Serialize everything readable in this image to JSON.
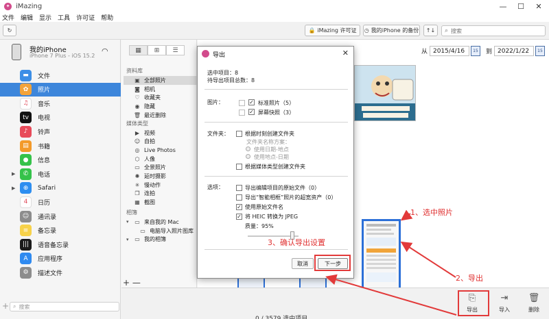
{
  "app": {
    "title": "iMazing"
  },
  "window_controls": {
    "minimize": "—",
    "maximize": "☐",
    "close": "✕"
  },
  "menu": [
    "文件",
    "编辑",
    "显示",
    "工具",
    "许可证",
    "帮助"
  ],
  "toolbar": {
    "license_label": "iMazing 许可证",
    "backup_label": "我的iPhone 的备份",
    "search_placeholder": "搜索",
    "refresh_icon": "↻",
    "sort_icon": "↑↓"
  },
  "device": {
    "name": "我的iPhone",
    "subtitle": "iPhone 7 Plus - iOS 15.2"
  },
  "sidebar": {
    "items": [
      {
        "label": "文件",
        "icon": "folder-icon",
        "color": "#3c8ee6",
        "glyph": "▬"
      },
      {
        "label": "照片",
        "icon": "photos-icon",
        "color": "#f2a33a",
        "glyph": "✿",
        "active": true
      },
      {
        "label": "音乐",
        "icon": "music-icon",
        "color": "#ffffff",
        "glyph": "♫"
      },
      {
        "label": "电视",
        "icon": "tv-icon",
        "color": "#111111",
        "glyph": "tv"
      },
      {
        "label": "铃声",
        "icon": "ringtone-icon",
        "color": "#e84b5a",
        "glyph": "♪"
      },
      {
        "label": "书籍",
        "icon": "books-icon",
        "color": "#f39a2a",
        "glyph": "▤"
      },
      {
        "label": "信息",
        "icon": "messages-icon",
        "color": "#35c24a",
        "glyph": "●"
      },
      {
        "label": "电话",
        "icon": "phone-icon",
        "color": "#35c24a",
        "glyph": "✆"
      },
      {
        "label": "Safari",
        "icon": "safari-icon",
        "color": "#2e8ef0",
        "glyph": "⊕"
      },
      {
        "label": "日历",
        "icon": "calendar-icon",
        "color": "#ffffff",
        "glyph": "4"
      },
      {
        "label": "通讯录",
        "icon": "contacts-icon",
        "color": "#8c8c8c",
        "glyph": "☺"
      },
      {
        "label": "备忘录",
        "icon": "notes-icon",
        "color": "#f7d24a",
        "glyph": "≡"
      },
      {
        "label": "语音备忘录",
        "icon": "voice-memo-icon",
        "color": "#1b1b1b",
        "glyph": "|||"
      },
      {
        "label": "应用程序",
        "icon": "app-store-icon",
        "color": "#2f8af0",
        "glyph": "A"
      },
      {
        "label": "描述文件",
        "icon": "settings-icon",
        "color": "#8d8d8d",
        "glyph": "⚙"
      }
    ],
    "search_placeholder": "搜索",
    "add": "+"
  },
  "library": {
    "section_library": "资料库",
    "library_items": [
      {
        "label": "全部照片",
        "glyph": "▣",
        "active": true
      },
      {
        "label": "相机",
        "glyph": "◙"
      },
      {
        "label": "收藏夹",
        "glyph": "♡"
      },
      {
        "label": "隐藏",
        "glyph": "◉"
      },
      {
        "label": "最近删除",
        "glyph": "🗑"
      }
    ],
    "section_media": "媒体类型",
    "media_items": [
      {
        "label": "视频",
        "glyph": "▶"
      },
      {
        "label": "自拍",
        "glyph": "☺"
      },
      {
        "label": "Live Photos",
        "glyph": "◎"
      },
      {
        "label": "人像",
        "glyph": "⬡"
      },
      {
        "label": "全景照片",
        "glyph": "▭"
      },
      {
        "label": "延时摄影",
        "glyph": "✺"
      },
      {
        "label": "慢动作",
        "glyph": "✳"
      },
      {
        "label": "连拍",
        "glyph": "❐"
      },
      {
        "label": "截图",
        "glyph": "▦"
      }
    ],
    "section_albums": "相簿",
    "album_items": [
      {
        "label": "来自我的 Mac",
        "glyph": "▭",
        "expanded": true
      },
      {
        "label": "电脑导入照片图库",
        "glyph": "▭",
        "child": true
      },
      {
        "label": "我的相簿",
        "glyph": "▭",
        "expanded": true
      }
    ],
    "footer": "+ —"
  },
  "date_range": {
    "from_label": "从",
    "from": "2015/4/16",
    "to_label": "到",
    "to": "2022/1/22",
    "cal": "15"
  },
  "status": {
    "text": "0 / 3579 选中项目"
  },
  "actions": [
    {
      "label": "导出",
      "icon": "export-icon",
      "glyph": "⎘"
    },
    {
      "label": "导入",
      "icon": "import-icon",
      "glyph": "⇥"
    },
    {
      "label": "删除",
      "icon": "trash-icon",
      "glyph": "🗑"
    }
  ],
  "dialog": {
    "title": "导出",
    "selected": "选中项目：8",
    "pending": "待导出项目总数：8",
    "pictures_label": "图片：",
    "opt_standard": "标准照片（5）",
    "opt_screenshot": "屏幕快照（3）",
    "folder_label": "文件夹：",
    "opt_by_time": "根据时刻创建文件夹",
    "folder_name_scheme": "文件夹名称方案：",
    "radio_date_place": "使用日期-地点",
    "radio_place_date": "使用地点-日期",
    "opt_by_media": "根据媒体类型创建文件夹",
    "options_label": "选项：",
    "opt_original": "导出编辑项目的原始文件（0）",
    "opt_smart": "导出“智能相框”照片的超宽资产（0）",
    "opt_original_name": "使用原始文件名",
    "opt_heic": "将 HEIC 转换为 JPEG",
    "quality": "质量：95%",
    "cancel": "取消",
    "next": "下一步",
    "close": "✕"
  },
  "annotations": {
    "step1": "1、选中照片",
    "step2": "2、导出",
    "step3": "3、确认导出设置"
  },
  "colors": {
    "accent": "#3d86db",
    "annotation": "#e23a3a"
  }
}
